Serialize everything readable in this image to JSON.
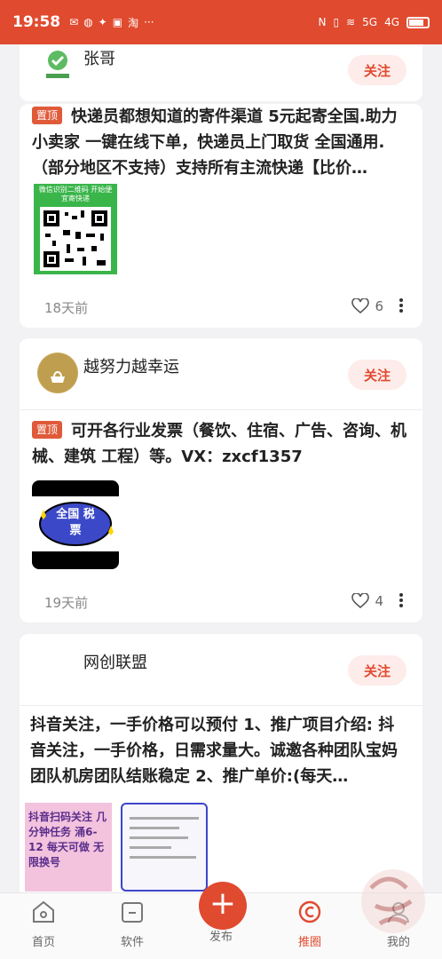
{
  "status_bar": {
    "time": "19:58",
    "left_icons": [
      "sms-icon",
      "wechat-icon",
      "app-icon",
      "browser-icon",
      "taobao-icon"
    ],
    "more": "···",
    "signal_labels": [
      "5G",
      "4G"
    ],
    "battery": "battery-icon"
  },
  "posts": [
    {
      "author": "张哥",
      "follow_label": "关注",
      "pinned": false,
      "text": "",
      "time": "",
      "likes": ""
    },
    {
      "author": "",
      "follow_label": "",
      "pinned": true,
      "pin_label": "置顶",
      "text": "快递员都想知道的寄件渠道 5元起寄全国.助力小卖家 一键在线下单，快递员上门取货 全国通用.（部分地区不支持）支持所有主流快递【比价…",
      "image_caption": "微信识别二维码 开始便宜寄快递",
      "time": "18天前",
      "likes": "6"
    },
    {
      "author": "越努力越幸运",
      "follow_label": "关注",
      "pinned": true,
      "pin_label": "置顶",
      "text": "可开各行业发票（餐饮、住宿、广告、咨询、机械、建筑 工程）等。VX：zxcf1357",
      "image_caption": "全国 税票",
      "time": "19天前",
      "likes": "4"
    },
    {
      "author": "网创联盟",
      "follow_label": "关注",
      "pinned": false,
      "text": "抖音关注，一手价格可以预付 1、推广项目介绍: 抖音关注，一手价格，日需求量大。诚邀各种团队宝妈团队机房团队结账稳定 2、推广单价:(每天…",
      "image_caption": "抖音扫码关注 几分钟任务 涌6-12 每天可做 无限换号"
    }
  ],
  "bottom_nav": {
    "items": [
      {
        "label": "首页",
        "icon": "home-icon"
      },
      {
        "label": "软件",
        "icon": "folder-icon"
      },
      {
        "label": "发布",
        "icon": "plus-icon"
      },
      {
        "label": "推圈",
        "icon": "circle-icon"
      },
      {
        "label": "我的",
        "icon": "user-icon"
      }
    ]
  },
  "colors": {
    "accent": "#e04a2f",
    "background": "#f2f2f4"
  }
}
